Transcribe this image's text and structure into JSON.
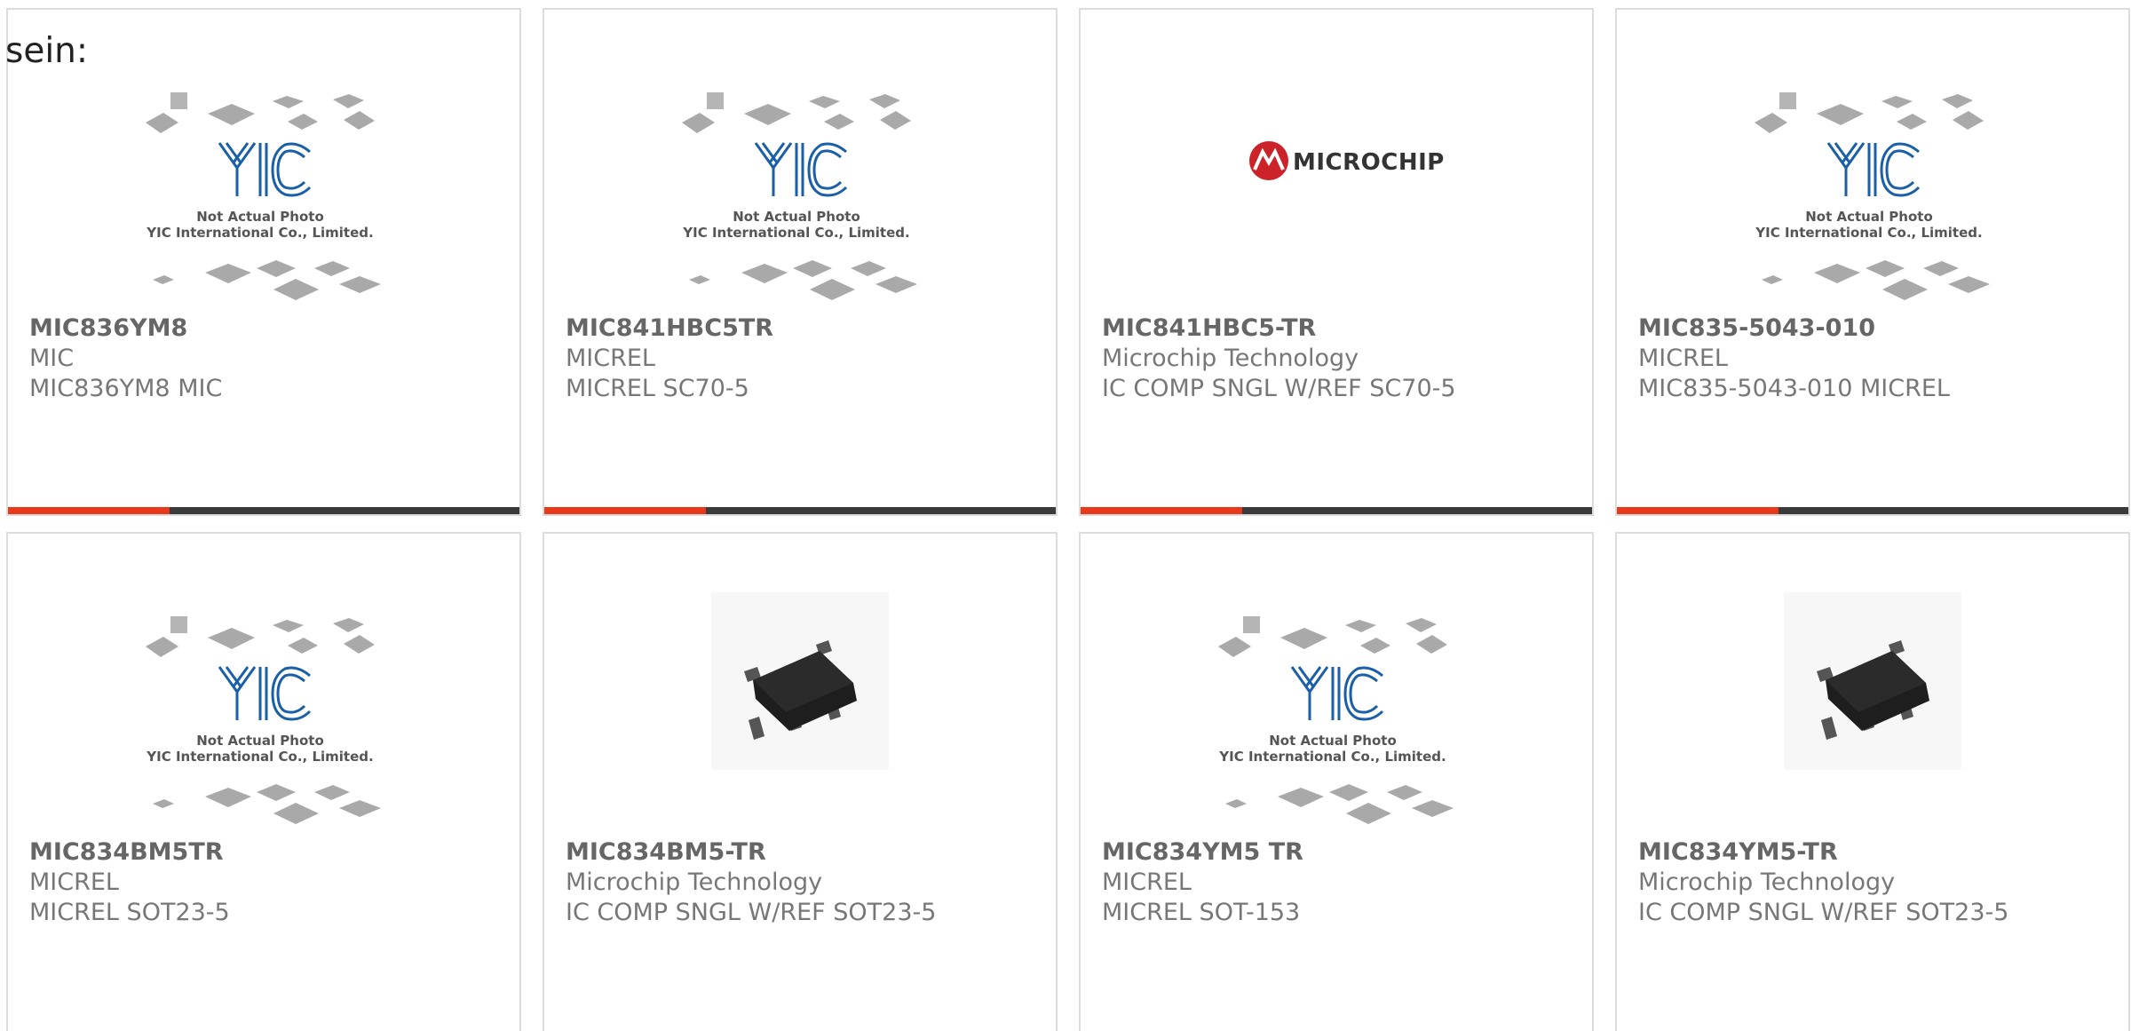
{
  "intro_text": "sein:",
  "placeholder": {
    "line1": "Not Actual Photo",
    "line2": "YIC International Co., Limited.",
    "logo": "YIC"
  },
  "microchip_logo": "MICROCHIP",
  "products": [
    {
      "part": "MIC836YM8",
      "brand": "MIC",
      "desc": "MIC836YM8 MIC",
      "image": "yic-placeholder"
    },
    {
      "part": "MIC841HBC5TR",
      "brand": "MICREL",
      "desc": "MICREL SC70-5",
      "image": "yic-placeholder"
    },
    {
      "part": "MIC841HBC5-TR",
      "brand": "Microchip Technology",
      "desc": "IC COMP SNGL W/REF SC70-5",
      "image": "microchip-logo"
    },
    {
      "part": "MIC835-5043-010",
      "brand": "MICREL",
      "desc": "MIC835-5043-010 MICREL",
      "image": "yic-placeholder"
    },
    {
      "part": "MIC834BM5TR",
      "brand": "MICREL",
      "desc": "MICREL SOT23-5",
      "image": "yic-placeholder"
    },
    {
      "part": "MIC834BM5-TR",
      "brand": "Microchip Technology",
      "desc": "IC COMP SNGL W/REF SOT23-5",
      "image": "sot23-chip"
    },
    {
      "part": "MIC834YM5 TR",
      "brand": "MICREL",
      "desc": "MICREL SOT-153",
      "image": "yic-placeholder"
    },
    {
      "part": "MIC834YM5-TR",
      "brand": "Microchip Technology",
      "desc": "IC COMP SNGL W/REF SOT23-5",
      "image": "sot23-chip"
    }
  ],
  "colors": {
    "accent": "#e8391b",
    "bar": "#3a3a3a",
    "border": "#dcdcdc",
    "yic_blue": "#1a5fa8",
    "microchip_red": "#cc2229"
  }
}
